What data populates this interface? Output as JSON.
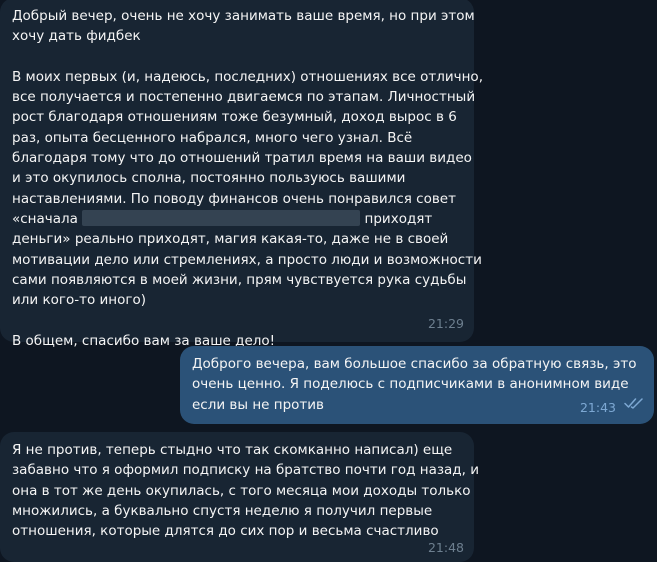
{
  "chat": {
    "messages": [
      {
        "direction": "incoming",
        "lines": [
          "Добрый вечер, очень не хочу занимать ваше время, но при этом",
          "хочу дать фидбек",
          "",
          "В моих первых (и, надеюсь, последних) отношениях все отлично,",
          "все получается и постепенно двигаемся по этапам. Личностный",
          "рост благодаря отношениям тоже безумный, доход вырос в 6",
          "раз, опыта бесценного набрался, много чего узнал. Всё",
          "благодаря тому что до отношений тратил время на ваши видео",
          "и это окупилось сполна, постоянно пользуюсь вашими",
          "наставлениями. По поводу финансов очень понравился совет"
        ],
        "redacted_line": {
          "before": "«сначала",
          "after": "приходят"
        },
        "lines_after": [
          "деньги» реально приходят, магия какая-то, даже не в своей",
          "мотивации дело или стремлениях, а просто люди и возможности",
          "сами появляются в моей жизни, прям чувствуется рука судьбы",
          "или кого-то иного)",
          "",
          "В общем, спасибо вам за ваше дело!"
        ],
        "time": "21:29"
      },
      {
        "direction": "outgoing",
        "lines": [
          "Доброго вечера, вам большое спасибо за обратную связь, это",
          "очень ценно. Я поделюсь с подписчиками в анонимном виде",
          "если вы не против"
        ],
        "time": "21:43",
        "status_icon": "double-check-icon",
        "status_color": "#7da8d3"
      },
      {
        "direction": "incoming",
        "lines": [
          "Я не против, теперь стыдно что так скомканно написал) еще",
          "забавно что я оформил подписку на братство почти год назад, и",
          "она в тот же день окупилась, с того месяца мои доходы только",
          "множились, а буквально спустя неделю я получил первые",
          "отношения, которые длятся до сих пор и весьма счастливо"
        ],
        "time": "21:48"
      }
    ]
  },
  "colors": {
    "background": "#0e1621",
    "incoming_bubble": "#182533",
    "outgoing_bubble": "#2b5278",
    "text": "#f5f5f5",
    "time_incoming": "#6d7f8f",
    "time_outgoing": "#7da8d3"
  }
}
